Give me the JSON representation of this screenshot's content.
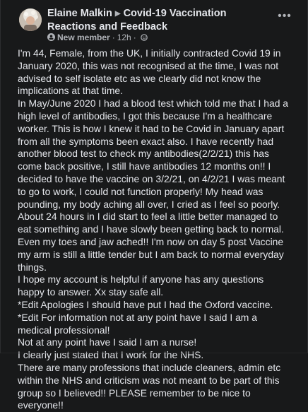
{
  "post": {
    "author": "Elaine Malkin",
    "group": "Covid-19 Vaccination Reactions and Feedback",
    "badge": "New member",
    "time": "12h",
    "separator": "·",
    "more_label": "•••",
    "body_paragraphs": [
      "I'm 44, Female, from the UK, I initially contracted Covid 19 in January 2020, this was not recognised at the time, I was not advised to self isolate etc as we clearly did not know the implications at that time.",
      "In May/June 2020 I had a blood test which told me that I had a high level of antibodies, I got this because I'm a healthcare worker.  This is how I knew it had to be Covid in January apart from all the symptoms been exact also.  I have recently had another blood test to check my antibodies(2/2/21) this has come back positive, I still have antibodies 12 months on!!   I decided to have the vaccine on 3/2/21, on 4/2/21 I was meant to go to work, I could not function properly! My head was pounding, my body aching all over, I cried as I feel so poorly.  About 24 hours in I did start to feel a little better managed to eat something and I have slowly been getting back to normal. Even my toes and jaw ached!!  I'm now on day 5 post Vaccine my arm is still a little tender but I am back to normal everyday things.",
      "I hope my account is helpful if anyone has any questions happy to answer. Xx stay safe all.",
      "*Edit Apologies I should have put I had the Oxford vaccine.",
      "*Edit For information not at any point have I said I am a medical professional!",
      "Not at any point have I said I am a nurse!",
      "I clearly just stated that I work for the NHS.",
      "There are many professions that include cleaners, admin etc within the NHS and criticism was not meant to be part of this group so I believed!! PLEASE remember to be nice to everyone!!"
    ]
  },
  "icons": {
    "avatar": "avatar",
    "caret": "caret-right-icon",
    "member": "new-member-icon",
    "privacy": "globe-icon",
    "more": "more-options-icon"
  },
  "colors": {
    "background": "#18191a",
    "primary_text": "#e4e6eb",
    "secondary_text": "#b0b3b8"
  }
}
